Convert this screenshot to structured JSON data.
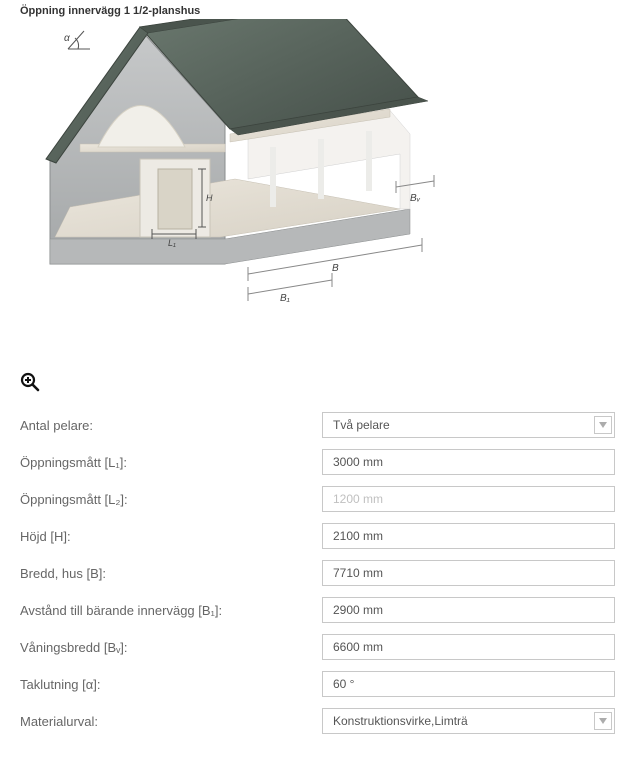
{
  "image_caption": "Öppning innervägg 1 1/2-planshus",
  "dim_labels": {
    "angle": "α",
    "H": "H",
    "L1": "L₁",
    "B": "B",
    "B1": "B₁",
    "Bv": "Bᵥ"
  },
  "form": {
    "rows": [
      {
        "label": "Antal pelare:",
        "type": "select",
        "value": "Två pelare",
        "disabled": false
      },
      {
        "label": "Öppningsmått [L₁]:",
        "type": "text",
        "value": "3000 mm",
        "disabled": false
      },
      {
        "label": "Öppningsmått [L₂]:",
        "type": "text",
        "value": "1200 mm",
        "disabled": true
      },
      {
        "label": "Höjd [H]:",
        "type": "text",
        "value": "2100 mm",
        "disabled": false
      },
      {
        "label": "Bredd, hus [B]:",
        "type": "text",
        "value": "7710 mm",
        "disabled": false
      },
      {
        "label": "Avstånd till bärande innervägg [B₁]:",
        "type": "text",
        "value": "2900 mm",
        "disabled": false
      },
      {
        "label": "Våningsbredd [Bᵥ]:",
        "type": "text",
        "value": "6600 mm",
        "disabled": false
      },
      {
        "label": "Taklutning [α]:",
        "type": "text",
        "value": "60 °",
        "disabled": false
      },
      {
        "label": "Materialurval:",
        "type": "select",
        "value": "Konstruktionsvirke,Limträ",
        "disabled": false
      }
    ]
  }
}
